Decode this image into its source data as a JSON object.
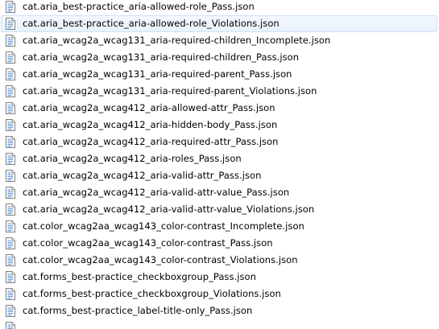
{
  "icon": "json-file-icon",
  "selected_index": 1,
  "files": [
    "cat.aria_best-practice_aria-allowed-role_Pass.json",
    "cat.aria_best-practice_aria-allowed-role_Violations.json",
    "cat.aria_wcag2a_wcag131_aria-required-children_Incomplete.json",
    "cat.aria_wcag2a_wcag131_aria-required-children_Pass.json",
    "cat.aria_wcag2a_wcag131_aria-required-parent_Pass.json",
    "cat.aria_wcag2a_wcag131_aria-required-parent_Violations.json",
    "cat.aria_wcag2a_wcag412_aria-allowed-attr_Pass.json",
    "cat.aria_wcag2a_wcag412_aria-hidden-body_Pass.json",
    "cat.aria_wcag2a_wcag412_aria-required-attr_Pass.json",
    "cat.aria_wcag2a_wcag412_aria-roles_Pass.json",
    "cat.aria_wcag2a_wcag412_aria-valid-attr_Pass.json",
    "cat.aria_wcag2a_wcag412_aria-valid-attr-value_Pass.json",
    "cat.aria_wcag2a_wcag412_aria-valid-attr-value_Violations.json",
    "cat.color_wcag2aa_wcag143_color-contrast_Incomplete.json",
    "cat.color_wcag2aa_wcag143_color-contrast_Pass.json",
    "cat.color_wcag2aa_wcag143_color-contrast_Violations.json",
    "cat.forms_best-practice_checkboxgroup_Pass.json",
    "cat.forms_best-practice_checkboxgroup_Violations.json",
    "cat.forms_best-practice_label-title-only_Pass.json",
    ""
  ]
}
